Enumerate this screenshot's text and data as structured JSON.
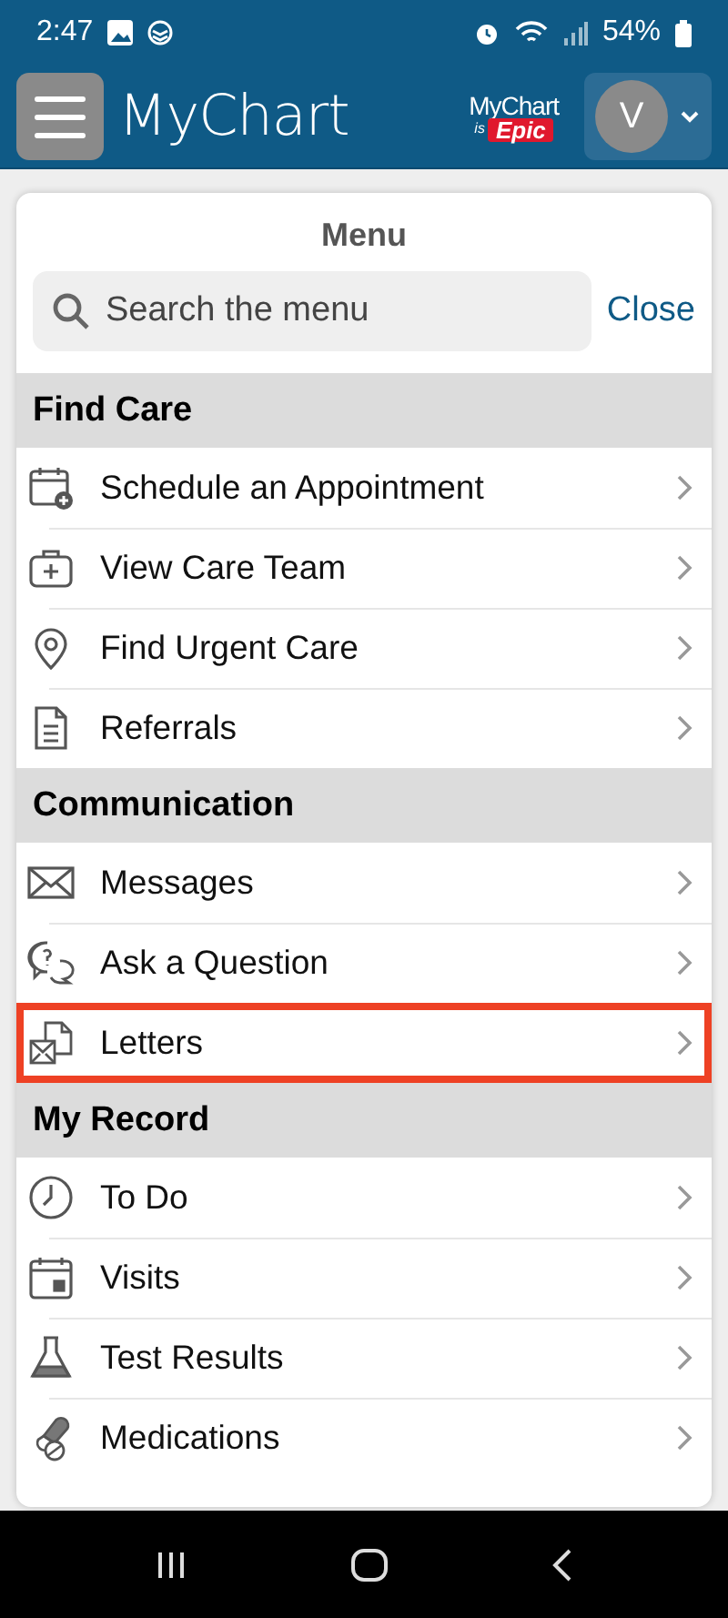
{
  "status_bar": {
    "time": "2:47",
    "battery": "54%"
  },
  "header": {
    "logo": "MyChart",
    "badge_top": "MyChart",
    "badge_is": "is",
    "badge_brand": "Epic",
    "avatar": "V"
  },
  "menu": {
    "title": "Menu",
    "search": {
      "placeholder": "Search the menu"
    },
    "close": "Close",
    "sections": [
      {
        "title": "Find Care",
        "items": [
          {
            "label": "Schedule an Appointment",
            "kind": "calendar-plus",
            "highlighted": false
          },
          {
            "label": "View Care Team",
            "kind": "medkit",
            "highlighted": false
          },
          {
            "label": "Find Urgent Care",
            "kind": "pin",
            "highlighted": false
          },
          {
            "label": "Referrals",
            "kind": "document",
            "highlighted": false
          }
        ]
      },
      {
        "title": "Communication",
        "items": [
          {
            "label": "Messages",
            "kind": "envelope",
            "highlighted": false
          },
          {
            "label": "Ask a Question",
            "kind": "chat",
            "highlighted": false
          },
          {
            "label": "Letters",
            "kind": "letters",
            "highlighted": true
          }
        ]
      },
      {
        "title": "My Record",
        "items": [
          {
            "label": "To Do",
            "kind": "clock",
            "highlighted": false
          },
          {
            "label": "Visits",
            "kind": "calendar",
            "highlighted": false
          },
          {
            "label": "Test Results",
            "kind": "flask",
            "highlighted": false
          },
          {
            "label": "Medications",
            "kind": "pill",
            "highlighted": false
          }
        ]
      }
    ]
  }
}
